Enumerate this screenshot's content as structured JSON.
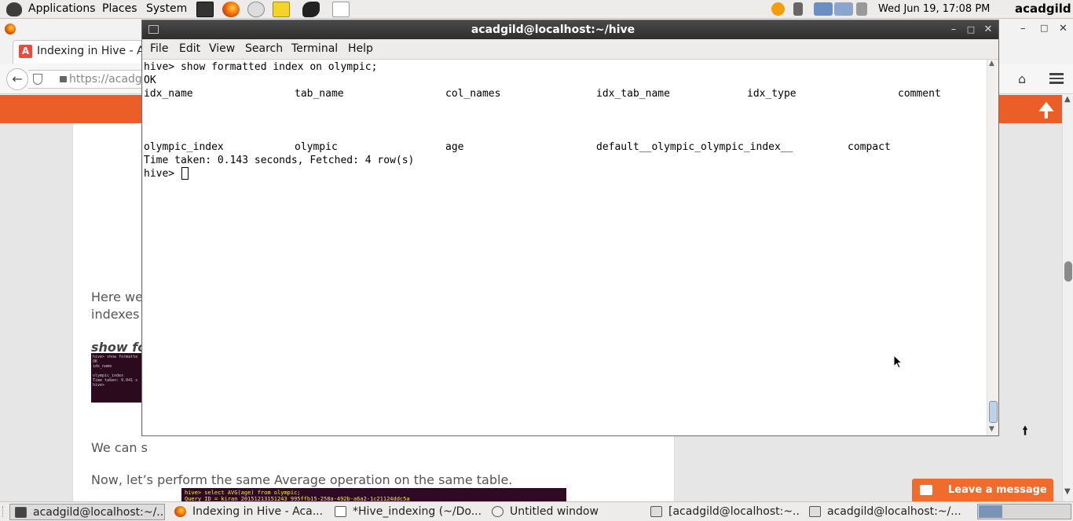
{
  "top_panel": {
    "menus": [
      "Applications",
      "Places",
      "System"
    ],
    "clock": "Wed Jun 19, 17:08 PM",
    "user": "acadgild"
  },
  "firefox": {
    "tab_title": "Indexing in Hive - Ac",
    "url": "https://acadgi",
    "article": {
      "line1": "Here we",
      "line2": "indexes c",
      "bold_cmd": "show fo",
      "we_can": "We can s",
      "paragraph": "Now, let’s perform the same Average operation on the same table.",
      "thumb1_text": "hive> show formatte\nOK\nidx_name\n\nolympic_index\nTime taken: 0.041 s\nhive>",
      "thumb2_text": "hive> select AVG(age) from olympic;\nQuery ID = kiran_20151213151243_995ffb15-258a-492b-a6a2-1c21124ddc5a"
    },
    "leave_message": "Leave a message"
  },
  "terminal": {
    "title": "acadgild@localhost:~/hive",
    "menus": [
      "File",
      "Edit",
      "View",
      "Search",
      "Terminal",
      "Help"
    ],
    "command": "hive> show formatted index on olympic;",
    "ok": "OK",
    "columns": [
      "idx_name",
      "tab_name",
      "col_names",
      "idx_tab_name",
      "idx_type",
      "comment"
    ],
    "row": [
      "olympic_index",
      "olympic",
      "age",
      "default__olympic_olympic_index__",
      "compact"
    ],
    "time_line": "Time taken: 0.143 seconds, Fetched: 4 row(s)",
    "prompt": "hive> "
  },
  "taskbar": {
    "items": [
      "acadgild@localhost:~/...",
      "Indexing in Hive - Aca...",
      "*Hive_indexing (~/Do...",
      "Untitled window",
      "[acadgild@localhost:~...",
      "acadgild@localhost:~/..."
    ]
  }
}
